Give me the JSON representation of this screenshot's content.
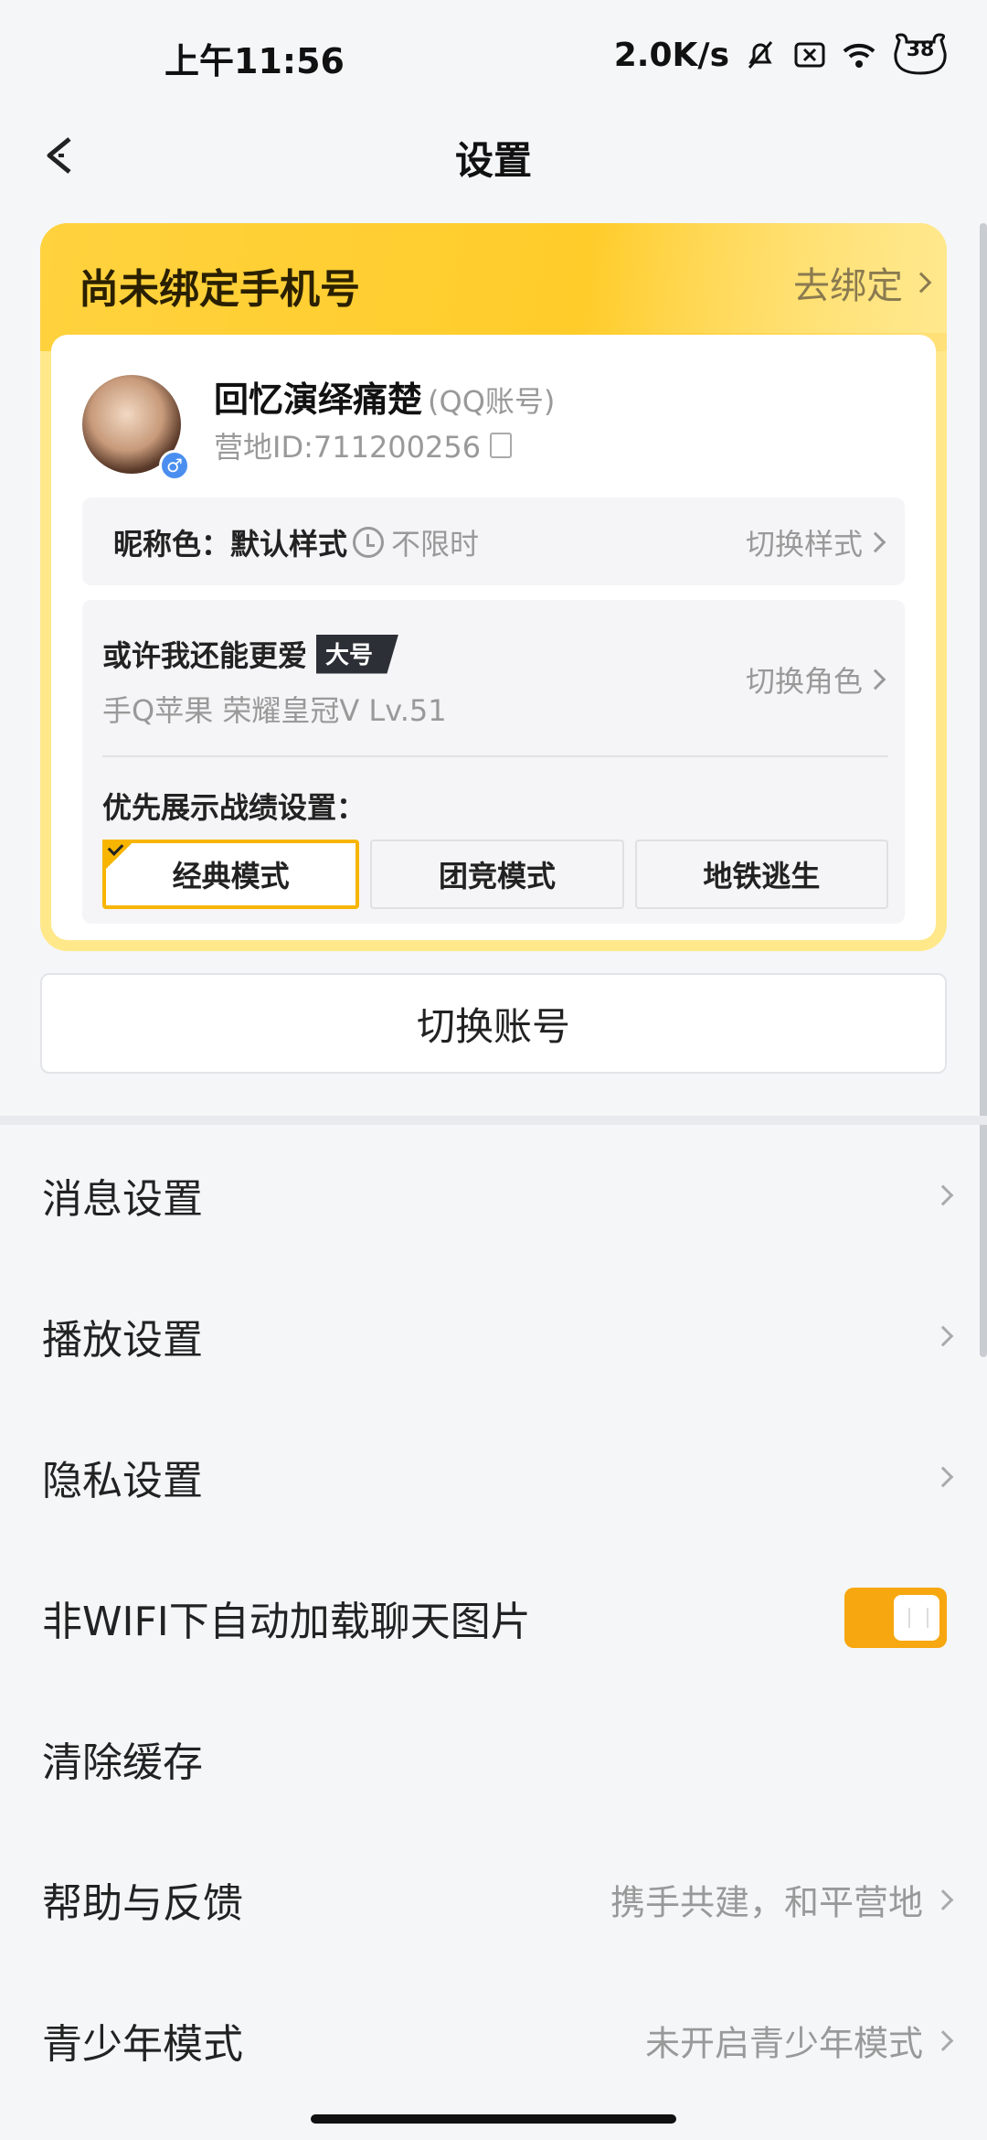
{
  "status_bar": {
    "time": "上午11:56",
    "speed": "2.0K/s",
    "battery": "38"
  },
  "header": {
    "title": "设置"
  },
  "account_card": {
    "bind_prompt": "尚未绑定手机号",
    "bind_action": "去绑定",
    "nickname": "回忆演绎痛楚",
    "account_type": "(QQ账号)",
    "camp_id": "营地ID:711200256",
    "nick_color_label": "昵称色：默认样式",
    "nick_color_limit": "不限时",
    "nick_color_switch": "切换样式",
    "role": {
      "name": "或许我还能更爱",
      "badge": "大号",
      "sub": "手Q苹果   荣耀皇冠V   Lv.51",
      "switch_label": "切换角色"
    },
    "pref_label": "优先展示战绩设置：",
    "modes": [
      "经典模式",
      "团竞模式",
      "地铁逃生"
    ],
    "selected_mode": "经典模式"
  },
  "switch_account_label": "切换账号",
  "settings": [
    {
      "label": "消息设置",
      "value": ""
    },
    {
      "label": "播放设置",
      "value": ""
    },
    {
      "label": "隐私设置",
      "value": ""
    },
    {
      "label": "非WIFI下自动加载聊天图片",
      "toggle_on": true
    },
    {
      "label": "清除缓存",
      "value": ""
    },
    {
      "label": "帮助与反馈",
      "value": "携手共建，和平营地"
    },
    {
      "label": "青少年模式",
      "value": "未开启青少年模式"
    }
  ],
  "colors": {
    "accent": "#f7b500",
    "toggle": "#f7a70f",
    "band": "#ffd23e"
  }
}
